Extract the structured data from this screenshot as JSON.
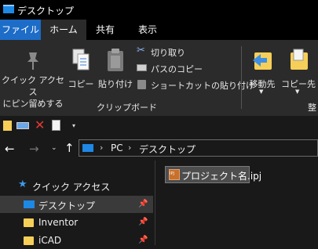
{
  "window": {
    "title": "デスクトップ"
  },
  "tabs": {
    "file": "ファイル",
    "home": "ホーム",
    "share": "共有",
    "view": "表示"
  },
  "ribbon": {
    "pin_quick_access": "クイック アクセス\nにピン留めする",
    "copy": "コピー",
    "paste": "貼り付け",
    "cut": "切り取り",
    "copy_path": "パスのコピー",
    "paste_shortcut": "ショートカットの貼り付け",
    "group_clipboard": "クリップボード",
    "move_to": "移動先",
    "copy_to": "コピー先",
    "group_organize_partial": "整"
  },
  "address": {
    "segments": [
      "PC",
      "デスクトップ"
    ]
  },
  "nav": {
    "quick_access": "クイック アクセス",
    "items": [
      {
        "label": "デスクトップ",
        "icon": "desktop-icon",
        "pinned": true,
        "selected": true
      },
      {
        "label": "Inventor",
        "icon": "folder-icon",
        "pinned": true,
        "selected": false
      },
      {
        "label": "iCAD",
        "icon": "folder-icon",
        "pinned": true,
        "selected": false
      }
    ]
  },
  "files": [
    {
      "name": "プロジェクト名.ipj",
      "icon": "ipj-file-icon",
      "badge": "IPJ",
      "selected": true
    }
  ],
  "colors": {
    "accent": "#1c6cc8",
    "background": "#191919",
    "ribbon": "#2b2b2b",
    "folder": "#f6cf59"
  }
}
